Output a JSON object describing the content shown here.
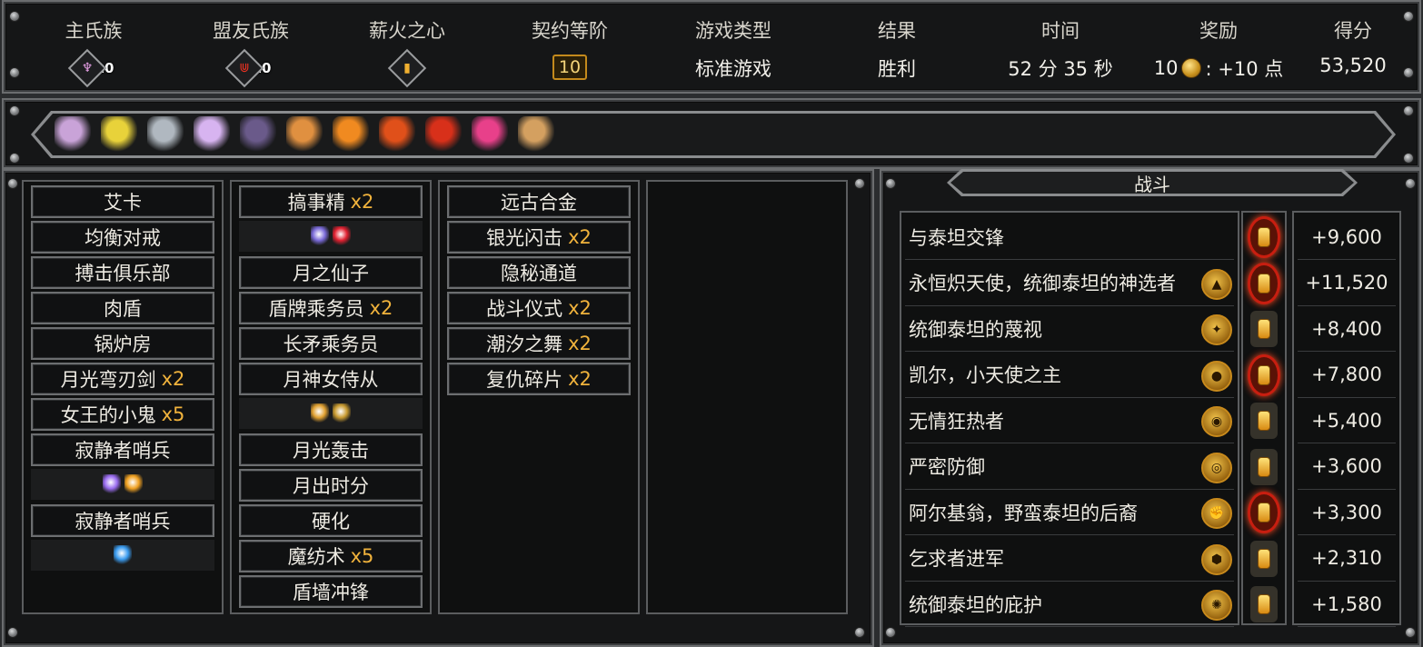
{
  "stats": {
    "main_clan_label": "主氏族",
    "main_clan_level": "10",
    "ally_clan_label": "盟友氏族",
    "ally_clan_level": "10",
    "pyre_heart_label": "薪火之心",
    "covenant_label": "契约等阶",
    "covenant_value": "10",
    "game_type_label": "游戏类型",
    "game_type_value": "标准游戏",
    "result_label": "结果",
    "result_value": "胜利",
    "time_label": "时间",
    "time_value": "52 分 35 秒",
    "reward_label": "奖励",
    "reward_amount": "10",
    "reward_suffix": ": +10 点",
    "score_label": "得分",
    "score_value": "53,520"
  },
  "relics": [
    {
      "icon": "winged-box-relic-icon",
      "color": "#c9a3d8"
    },
    {
      "icon": "golden-shard-relic-icon",
      "color": "#e8d23a"
    },
    {
      "icon": "hammer-relic-icon",
      "color": "#b0b8c0"
    },
    {
      "icon": "crystal-tree-relic-icon",
      "color": "#d7b4f0"
    },
    {
      "icon": "dark-horn-relic-icon",
      "color": "#6a5a8a"
    },
    {
      "icon": "mystery-box-relic-icon",
      "color": "#e09040"
    },
    {
      "icon": "fire-scroll-relic-icon",
      "color": "#f08a20"
    },
    {
      "icon": "fire-idol-relic-icon",
      "color": "#e0501a"
    },
    {
      "icon": "red-feather-relic-icon",
      "color": "#d8301a"
    },
    {
      "icon": "pink-serpent-relic-icon",
      "color": "#e8408a"
    },
    {
      "icon": "compass-relic-icon",
      "color": "#d4a060"
    }
  ],
  "deck": {
    "columns": [
      [
        {
          "type": "card",
          "name": "艾卡",
          "mult": ""
        },
        {
          "type": "card",
          "name": "均衡对戒",
          "mult": ""
        },
        {
          "type": "card",
          "name": "搏击俱乐部",
          "mult": ""
        },
        {
          "type": "card",
          "name": "肉盾",
          "mult": ""
        },
        {
          "type": "card",
          "name": "锅炉房",
          "mult": ""
        },
        {
          "type": "card",
          "name": "月光弯刃剑",
          "mult": "x2"
        },
        {
          "type": "card",
          "name": "女王的小鬼",
          "mult": "x5"
        },
        {
          "type": "card",
          "name": "寂静者哨兵",
          "mult": ""
        },
        {
          "type": "upgrades",
          "gems": [
            "purple-gem-icon",
            "amber-gem-icon"
          ]
        },
        {
          "type": "card",
          "name": "寂静者哨兵",
          "mult": ""
        },
        {
          "type": "upgrades",
          "gems": [
            "blue-hourglass-gem-icon"
          ]
        }
      ],
      [
        {
          "type": "card",
          "name": "搞事精",
          "mult": "x2"
        },
        {
          "type": "upgrades",
          "gems": [
            "moon-gem-icon",
            "heart-gem-icon"
          ]
        },
        {
          "type": "card",
          "name": "月之仙子",
          "mult": ""
        },
        {
          "type": "card",
          "name": "盾牌乘务员",
          "mult": "x2"
        },
        {
          "type": "card",
          "name": "长矛乘务员",
          "mult": ""
        },
        {
          "type": "card",
          "name": "月神女侍从",
          "mult": ""
        },
        {
          "type": "upgrades",
          "gems": [
            "boot-gem-icon",
            "trident-gem-icon"
          ]
        },
        {
          "type": "card",
          "name": "月光轰击",
          "mult": ""
        },
        {
          "type": "card",
          "name": "月出时分",
          "mult": ""
        },
        {
          "type": "card",
          "name": "硬化",
          "mult": ""
        },
        {
          "type": "card",
          "name": "魔纺术",
          "mult": "x5"
        },
        {
          "type": "card",
          "name": "盾墙冲锋",
          "mult": ""
        }
      ],
      [
        {
          "type": "card",
          "name": "远古合金",
          "mult": ""
        },
        {
          "type": "card",
          "name": "银光闪击",
          "mult": "x2"
        },
        {
          "type": "card",
          "name": "隐秘通道",
          "mult": ""
        },
        {
          "type": "card",
          "name": "战斗仪式",
          "mult": "x2"
        },
        {
          "type": "card",
          "name": "潮汐之舞",
          "mult": "x2"
        },
        {
          "type": "card",
          "name": "复仇碎片",
          "mult": "x2"
        }
      ],
      []
    ]
  },
  "combat": {
    "title": "战斗",
    "events": [
      {
        "name": "与泰坦交锋",
        "badge": "",
        "lamp": "hot",
        "score": "+9,600"
      },
      {
        "name": "永恒炽天使，统御泰坦的神选者",
        "badge": "▲",
        "lamp": "hot",
        "score": "+11,520"
      },
      {
        "name": "统御泰坦的蔑视",
        "badge": "✦",
        "lamp": "cool",
        "score": "+8,400"
      },
      {
        "name": "凯尔，小天使之主",
        "badge": "●",
        "lamp": "hot",
        "score": "+7,800"
      },
      {
        "name": "无情狂热者",
        "badge": "◉",
        "lamp": "cool",
        "score": "+5,400"
      },
      {
        "name": "严密防御",
        "badge": "◎",
        "lamp": "cool",
        "score": "+3,600"
      },
      {
        "name": "阿尔基翁，野蛮泰坦的后裔",
        "badge": "✊",
        "lamp": "hot",
        "score": "+3,300"
      },
      {
        "name": "乞求者进军",
        "badge": "⬢",
        "lamp": "cool",
        "score": "+2,310"
      },
      {
        "name": "统御泰坦的庇护",
        "badge": "✺",
        "lamp": "cool",
        "score": "+1,580"
      }
    ]
  }
}
